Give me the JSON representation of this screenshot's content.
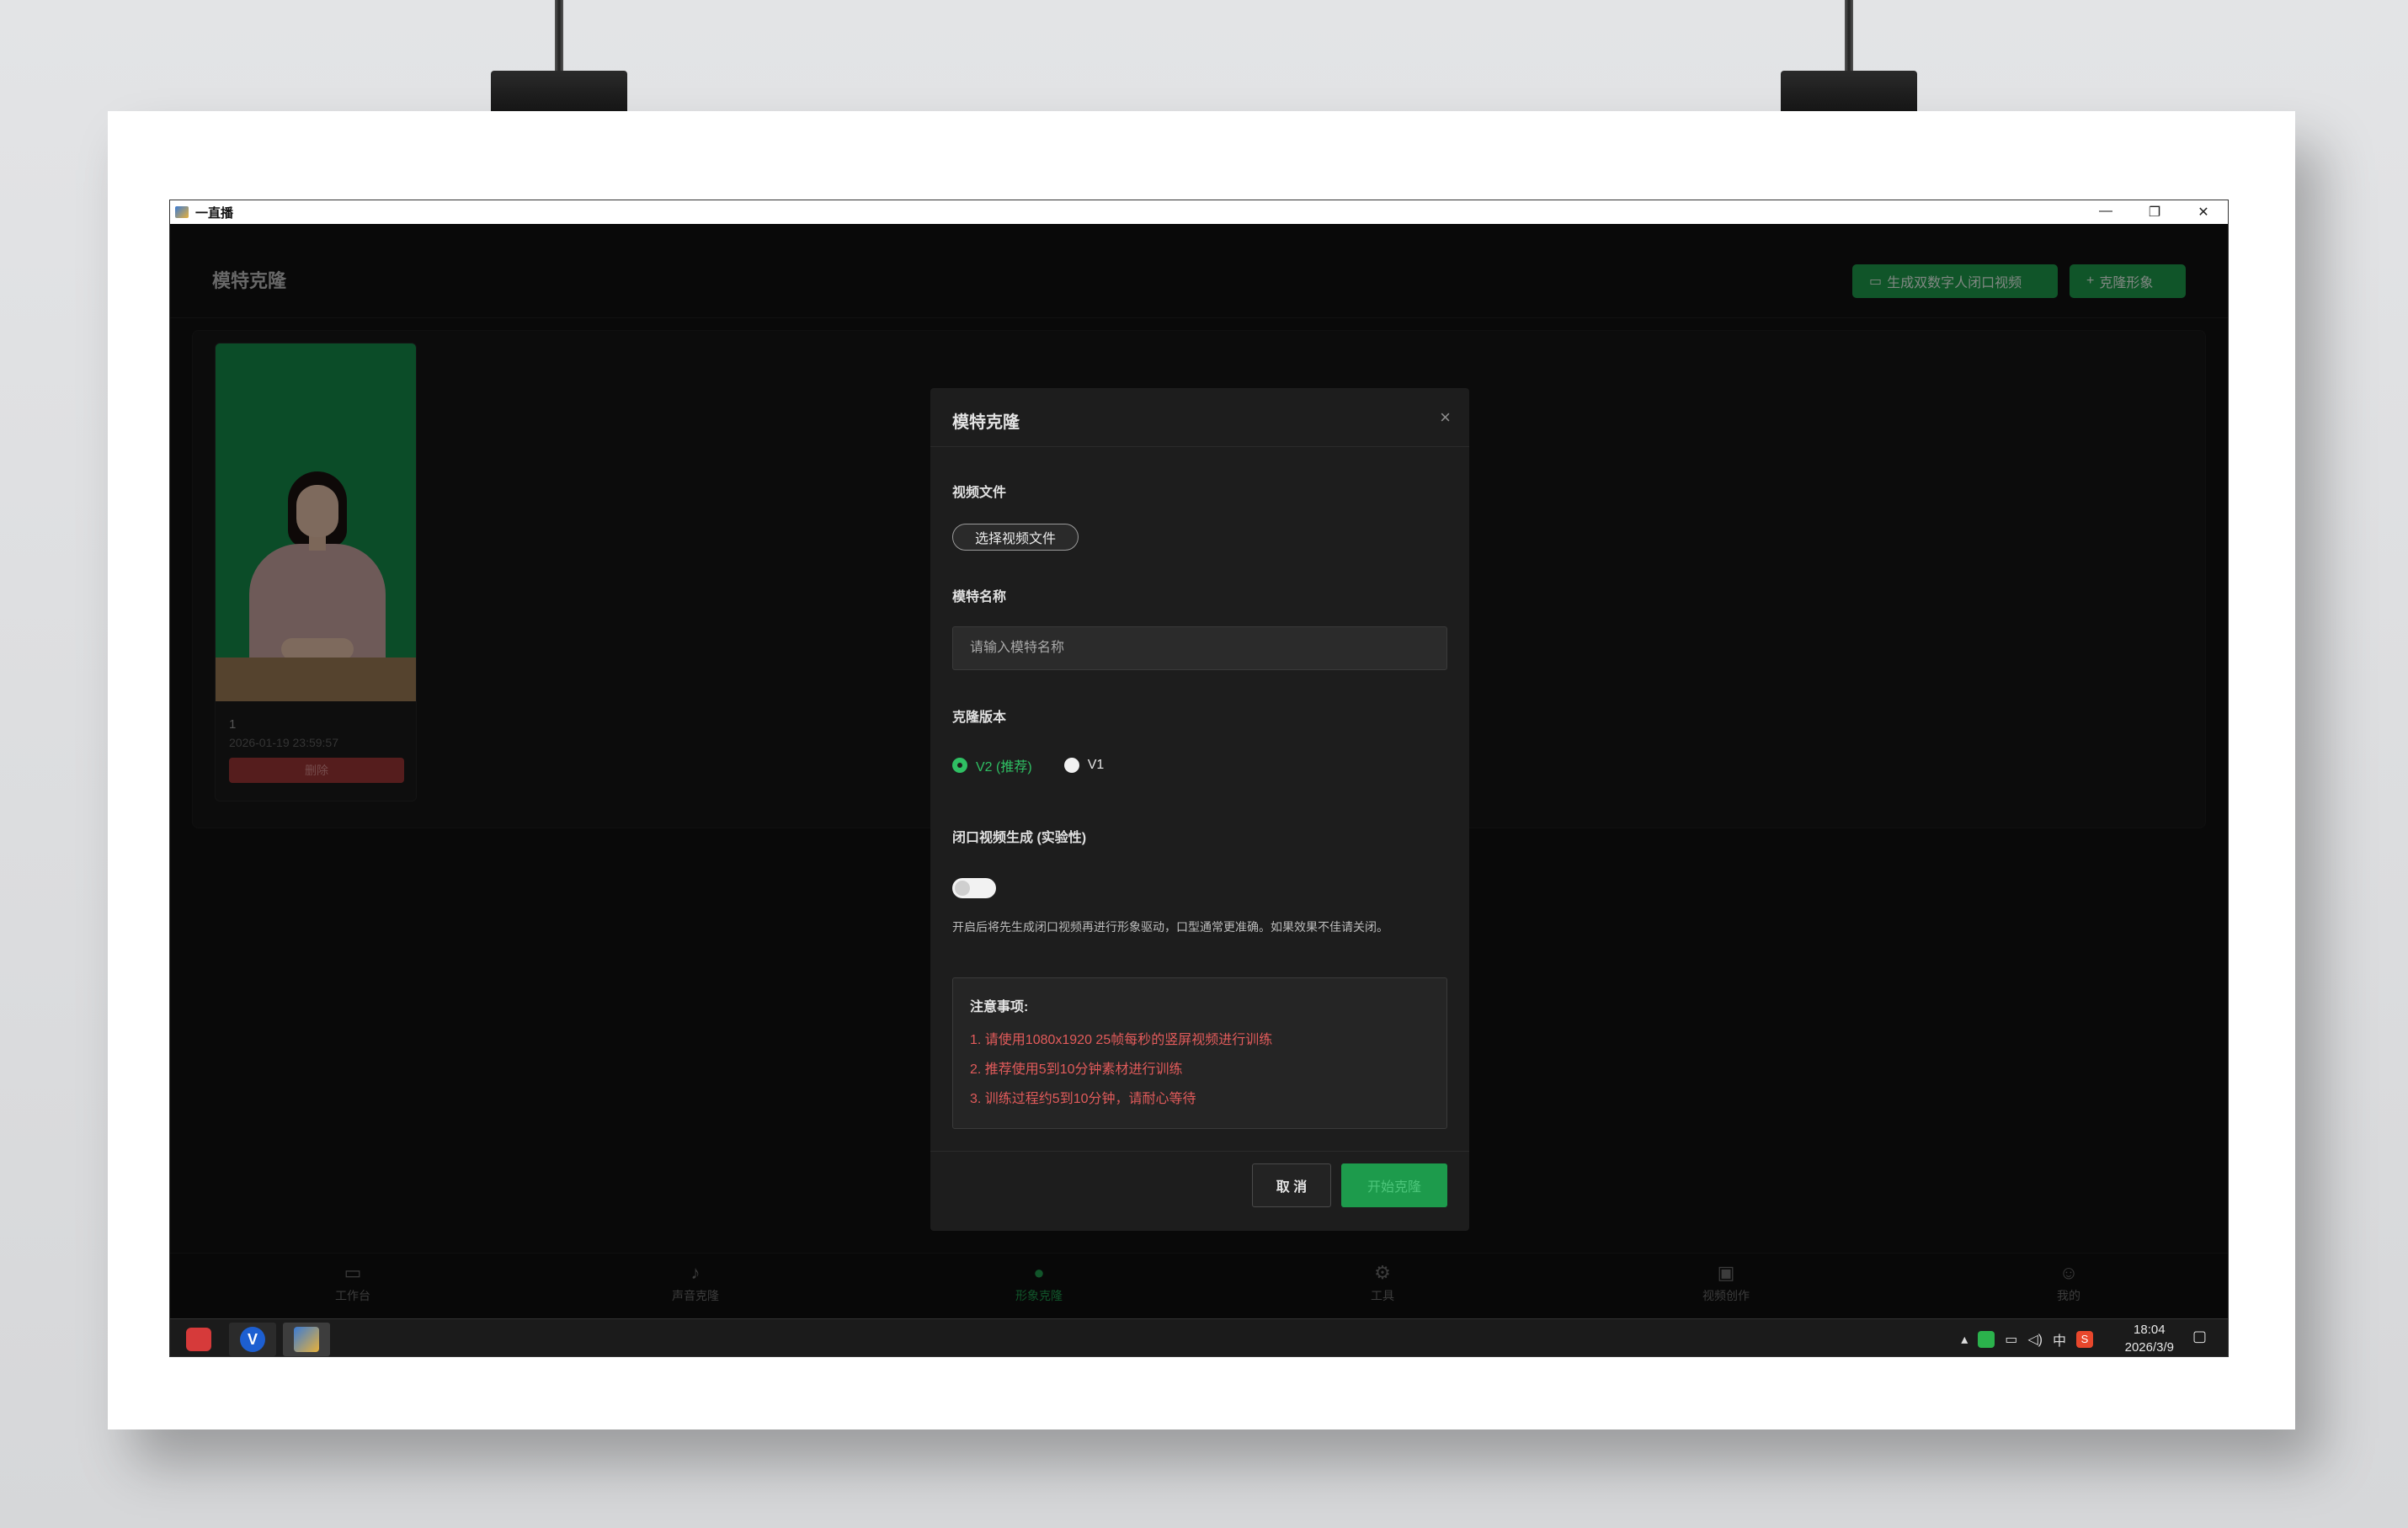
{
  "window": {
    "title": "一直播",
    "controls": {
      "minimize": "—",
      "restore": "❐",
      "close": "✕"
    }
  },
  "page": {
    "title": "模特克隆",
    "generate_button": "生成双数字人闭口视频",
    "generate_icon": "video-camera-icon",
    "clone_button": "克隆形象",
    "clone_icon": "plus-icon"
  },
  "models": [
    {
      "name": "1",
      "created": "2026-01-19 23:59:57",
      "delete_label": "删除"
    }
  ],
  "modal": {
    "title": "模特克隆",
    "close_symbol": "×",
    "video_label": "视频文件",
    "choose_file": "选择视频文件",
    "name_label": "模特名称",
    "name_placeholder": "请输入模特名称",
    "name_value": "",
    "version_label": "克隆版本",
    "versions": [
      {
        "label": "V2 (推荐)",
        "selected": true
      },
      {
        "label": "V1",
        "selected": false
      }
    ],
    "closed_mouth_label": "闭口视频生成 (实验性)",
    "closed_mouth_enabled": false,
    "hint": "开启后将先生成闭口视频再进行形象驱动，口型通常更准确。如果效果不佳请关闭。",
    "notice": {
      "title": "注意事项:",
      "items": [
        "1. 请使用1080x1920 25帧每秒的竖屏视频进行训练",
        "2. 推荐使用5到10分钟素材进行训练",
        "3. 训练过程约5到10分钟，请耐心等待"
      ]
    },
    "cancel_label": "取 消",
    "start_label": "开始克隆"
  },
  "bottom_nav": [
    {
      "label": "工作台",
      "icon": "monitor-icon",
      "active": false
    },
    {
      "label": "声音克隆",
      "icon": "microphone-icon",
      "active": false
    },
    {
      "label": "形象克隆",
      "icon": "person-icon",
      "active": true
    },
    {
      "label": "工具",
      "icon": "gear-icon",
      "active": false
    },
    {
      "label": "视频创作",
      "icon": "video-camera-icon",
      "active": false
    },
    {
      "label": "我的",
      "icon": "user-icon",
      "active": false
    }
  ],
  "taskbar": {
    "tray_ime": "中",
    "time": "18:04",
    "date": "2026/3/9"
  },
  "colors": {
    "accent": "#1e9b4b",
    "danger": "#e25b5b",
    "background": "#121212"
  }
}
